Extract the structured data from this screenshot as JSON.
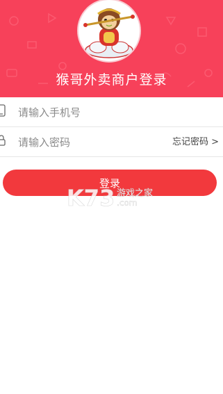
{
  "header": {
    "title": "猴哥外卖商户登录",
    "logo": "monkey-king-on-cloud",
    "background_color": "#f7415a"
  },
  "form": {
    "phone": {
      "placeholder": "请输入手机号",
      "value": "",
      "icon": "phone-icon"
    },
    "password": {
      "placeholder": "请输入密码",
      "value": "",
      "icon": "lock-icon"
    },
    "forgot_label": "忘记密码 >"
  },
  "login": {
    "label": "登录",
    "color": "#f2393d"
  },
  "watermark": {
    "brand": "K73",
    "cn": "游戏之家",
    "domain": ".com"
  }
}
